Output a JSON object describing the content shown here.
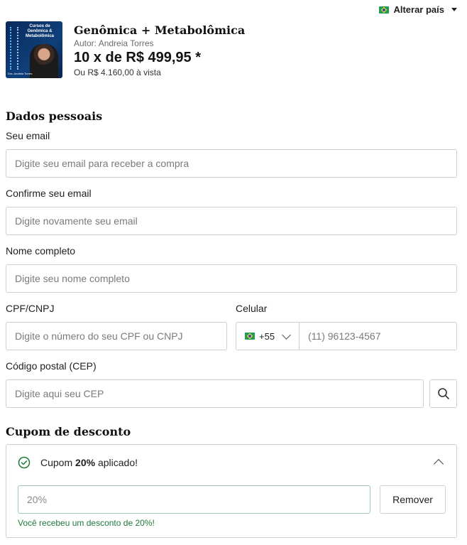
{
  "header": {
    "country_switch_label": "Alterar país"
  },
  "product": {
    "cover_title": "Cursos de Genômica & Metabolômica",
    "cover_author": "Dra. Andreia Torres",
    "title": "Genômica + Metabolômica",
    "author": "Autor: Andreia Torres",
    "installments": "10 x de R$ 499,95 *",
    "cash_price": "Ou R$ 4.160,00 à vista"
  },
  "personal": {
    "section_title": "Dados pessoais",
    "email_label": "Seu email",
    "email_placeholder": "Digite seu email para receber a compra",
    "confirm_email_label": "Confirme seu email",
    "confirm_email_placeholder": "Digite novamente seu email",
    "name_label": "Nome completo",
    "name_placeholder": "Digite seu nome completo",
    "cpf_label": "CPF/CNPJ",
    "cpf_placeholder": "Digite o número do seu CPF ou CNPJ",
    "phone_label": "Celular",
    "phone_country_code": "+55",
    "phone_placeholder": "(11) 96123-4567",
    "cep_label": "Código postal (CEP)",
    "cep_placeholder": "Digite aqui seu CEP"
  },
  "coupon": {
    "section_title": "Cupom de desconto",
    "status_prefix": "Cupom ",
    "status_value": "20%",
    "status_suffix": " aplicado!",
    "input_value": "20%",
    "remove_label": "Remover",
    "message": "Você recebeu um desconto de 20%!"
  },
  "colors": {
    "success_green": "#1f7a3a",
    "border": "#cfcfcf",
    "text": "#1f1f1f"
  },
  "icons": {
    "country_flag": "brazil-flag-icon",
    "search": "search-icon",
    "coupon_status": "check-circle-icon",
    "collapse": "chevron-up-icon"
  }
}
